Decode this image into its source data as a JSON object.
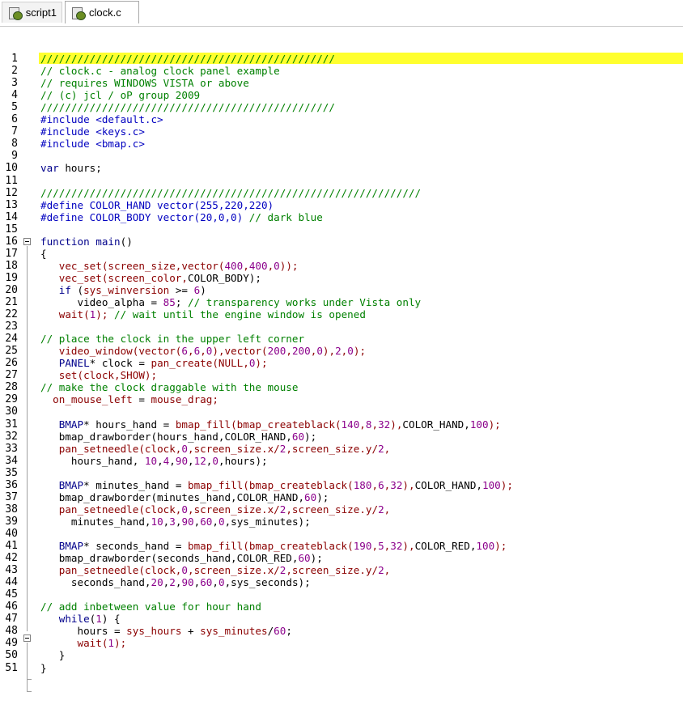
{
  "tabs": [
    {
      "label": "script1",
      "active": false,
      "icon": "script-file-icon"
    },
    {
      "label": "clock.c",
      "active": true,
      "icon": "script-file-icon"
    }
  ],
  "colors": {
    "highlight": "#ffff2e",
    "comment": "#008000",
    "keyword": "#00008b",
    "preprocessor": "#0000c0",
    "function": "#8b0000",
    "number": "#8b008b"
  },
  "lines": [
    {
      "n": "1",
      "segs": [
        [
          "cm",
          "////////////////////////////////////////////////"
        ]
      ]
    },
    {
      "n": "2",
      "segs": [
        [
          "cm",
          "// clock.c - analog clock panel example"
        ]
      ]
    },
    {
      "n": "3",
      "segs": [
        [
          "cm",
          "// requires WINDOWS VISTA or above"
        ]
      ]
    },
    {
      "n": "4",
      "segs": [
        [
          "cm",
          "// (c) jcl / oP group 2009"
        ]
      ]
    },
    {
      "n": "5",
      "segs": [
        [
          "cm",
          "////////////////////////////////////////////////"
        ]
      ]
    },
    {
      "n": "6",
      "segs": [
        [
          "pp",
          "#include <default.c>"
        ]
      ]
    },
    {
      "n": "7",
      "segs": [
        [
          "pp",
          "#include <keys.c>"
        ]
      ]
    },
    {
      "n": "8",
      "segs": [
        [
          "pp",
          "#include <bmap.c>"
        ]
      ]
    },
    {
      "n": "9",
      "segs": []
    },
    {
      "n": "10",
      "segs": [
        [
          "kw",
          "var"
        ],
        [
          "def",
          " hours;"
        ]
      ]
    },
    {
      "n": "11",
      "segs": []
    },
    {
      "n": "12",
      "segs": [
        [
          "cm",
          "//////////////////////////////////////////////////////////////"
        ]
      ]
    },
    {
      "n": "13",
      "segs": [
        [
          "pp",
          "#define COLOR_HAND vector(255,220,220)"
        ]
      ]
    },
    {
      "n": "14",
      "segs": [
        [
          "pp",
          "#define COLOR_BODY vector(20,0,0) "
        ],
        [
          "cm",
          "// dark blue"
        ]
      ]
    },
    {
      "n": "15",
      "segs": []
    },
    {
      "n": "16",
      "segs": [
        [
          "kw",
          "function"
        ],
        [
          "def",
          " "
        ],
        [
          "kw",
          "main"
        ],
        [
          "def",
          "()"
        ]
      ]
    },
    {
      "n": "17",
      "segs": [
        [
          "def",
          "{"
        ]
      ]
    },
    {
      "n": "18",
      "segs": [
        [
          "def",
          "   "
        ],
        [
          "fn",
          "vec_set(screen_size,vector("
        ],
        [
          "num",
          "400"
        ],
        [
          "fn",
          ","
        ],
        [
          "num",
          "400"
        ],
        [
          "fn",
          ","
        ],
        [
          "num",
          "0"
        ],
        [
          "fn",
          "));"
        ]
      ]
    },
    {
      "n": "19",
      "segs": [
        [
          "def",
          "   "
        ],
        [
          "fn",
          "vec_set(screen_color,"
        ],
        [
          "def",
          "COLOR_BODY);"
        ]
      ]
    },
    {
      "n": "20",
      "segs": [
        [
          "def",
          "   "
        ],
        [
          "kw",
          "if"
        ],
        [
          "def",
          " ("
        ],
        [
          "fn",
          "sys_winversion"
        ],
        [
          "def",
          " >= "
        ],
        [
          "num",
          "6"
        ],
        [
          "def",
          ")"
        ]
      ]
    },
    {
      "n": "21",
      "segs": [
        [
          "def",
          "      video_alpha = "
        ],
        [
          "num",
          "85"
        ],
        [
          "def",
          "; "
        ],
        [
          "cm",
          "// transparency works under Vista only"
        ]
      ]
    },
    {
      "n": "22",
      "segs": [
        [
          "def",
          "   "
        ],
        [
          "fn",
          "wait("
        ],
        [
          "num",
          "1"
        ],
        [
          "fn",
          ");"
        ],
        [
          "def",
          " "
        ],
        [
          "cm",
          "// wait until the engine window is opened"
        ]
      ]
    },
    {
      "n": "23",
      "segs": []
    },
    {
      "n": "24",
      "segs": [
        [
          "cm",
          "// place the clock in the upper left corner"
        ]
      ]
    },
    {
      "n": "25",
      "segs": [
        [
          "def",
          "   "
        ],
        [
          "fn",
          "video_window(vector("
        ],
        [
          "num",
          "6"
        ],
        [
          "fn",
          ","
        ],
        [
          "num",
          "6"
        ],
        [
          "fn",
          ","
        ],
        [
          "num",
          "0"
        ],
        [
          "fn",
          "),vector("
        ],
        [
          "num",
          "200"
        ],
        [
          "fn",
          ","
        ],
        [
          "num",
          "200"
        ],
        [
          "fn",
          ","
        ],
        [
          "num",
          "0"
        ],
        [
          "fn",
          "),"
        ],
        [
          "num",
          "2"
        ],
        [
          "fn",
          ","
        ],
        [
          "num",
          "0"
        ],
        [
          "fn",
          ");"
        ]
      ]
    },
    {
      "n": "26",
      "segs": [
        [
          "def",
          "   "
        ],
        [
          "kw",
          "PANEL"
        ],
        [
          "def",
          "* clock = "
        ],
        [
          "fn",
          "pan_create(NULL,"
        ],
        [
          "num",
          "0"
        ],
        [
          "fn",
          ");"
        ]
      ]
    },
    {
      "n": "27",
      "segs": [
        [
          "def",
          "   "
        ],
        [
          "fn",
          "set(clock,SHOW);"
        ]
      ]
    },
    {
      "n": "28",
      "segs": [
        [
          "cm",
          "// make the clock draggable with the mouse"
        ]
      ]
    },
    {
      "n": "29",
      "segs": [
        [
          "def",
          "  "
        ],
        [
          "fn",
          "on_mouse_left"
        ],
        [
          "def",
          " = "
        ],
        [
          "fn",
          "mouse_drag;"
        ]
      ]
    },
    {
      "n": "30",
      "segs": []
    },
    {
      "n": "31",
      "segs": [
        [
          "def",
          "   "
        ],
        [
          "kw",
          "BMAP"
        ],
        [
          "def",
          "* hours_hand = "
        ],
        [
          "fn",
          "bmap_fill(bmap_createblack("
        ],
        [
          "num",
          "140"
        ],
        [
          "fn",
          ","
        ],
        [
          "num",
          "8"
        ],
        [
          "fn",
          ","
        ],
        [
          "num",
          "32"
        ],
        [
          "fn",
          "),"
        ],
        [
          "def",
          "COLOR_HAND,"
        ],
        [
          "num",
          "100"
        ],
        [
          "fn",
          ");"
        ]
      ]
    },
    {
      "n": "32",
      "segs": [
        [
          "def",
          "   bmap_drawborder(hours_hand,COLOR_HAND,"
        ],
        [
          "num",
          "60"
        ],
        [
          "def",
          ");"
        ]
      ]
    },
    {
      "n": "33",
      "segs": [
        [
          "def",
          "   "
        ],
        [
          "fn",
          "pan_setneedle(clock,"
        ],
        [
          "num",
          "0"
        ],
        [
          "fn",
          ",screen_size.x/"
        ],
        [
          "num",
          "2"
        ],
        [
          "fn",
          ",screen_size.y/"
        ],
        [
          "num",
          "2"
        ],
        [
          "fn",
          ","
        ]
      ]
    },
    {
      "n": "34",
      "segs": [
        [
          "def",
          "     hours_hand, "
        ],
        [
          "num",
          "10"
        ],
        [
          "def",
          ","
        ],
        [
          "num",
          "4"
        ],
        [
          "def",
          ","
        ],
        [
          "num",
          "90"
        ],
        [
          "def",
          ","
        ],
        [
          "num",
          "12"
        ],
        [
          "def",
          ","
        ],
        [
          "num",
          "0"
        ],
        [
          "def",
          ",hours);"
        ]
      ]
    },
    {
      "n": "35",
      "segs": []
    },
    {
      "n": "36",
      "segs": [
        [
          "def",
          "   "
        ],
        [
          "kw",
          "BMAP"
        ],
        [
          "def",
          "* minutes_hand = "
        ],
        [
          "fn",
          "bmap_fill(bmap_createblack("
        ],
        [
          "num",
          "180"
        ],
        [
          "fn",
          ","
        ],
        [
          "num",
          "6"
        ],
        [
          "fn",
          ","
        ],
        [
          "num",
          "32"
        ],
        [
          "fn",
          "),"
        ],
        [
          "def",
          "COLOR_HAND,"
        ],
        [
          "num",
          "100"
        ],
        [
          "fn",
          ");"
        ]
      ]
    },
    {
      "n": "37",
      "segs": [
        [
          "def",
          "   bmap_drawborder(minutes_hand,COLOR_HAND,"
        ],
        [
          "num",
          "60"
        ],
        [
          "def",
          ");"
        ]
      ]
    },
    {
      "n": "38",
      "segs": [
        [
          "def",
          "   "
        ],
        [
          "fn",
          "pan_setneedle(clock,"
        ],
        [
          "num",
          "0"
        ],
        [
          "fn",
          ",screen_size.x/"
        ],
        [
          "num",
          "2"
        ],
        [
          "fn",
          ",screen_size.y/"
        ],
        [
          "num",
          "2"
        ],
        [
          "fn",
          ","
        ]
      ]
    },
    {
      "n": "39",
      "segs": [
        [
          "def",
          "     minutes_hand,"
        ],
        [
          "num",
          "10"
        ],
        [
          "def",
          ","
        ],
        [
          "num",
          "3"
        ],
        [
          "def",
          ","
        ],
        [
          "num",
          "90"
        ],
        [
          "def",
          ","
        ],
        [
          "num",
          "60"
        ],
        [
          "def",
          ","
        ],
        [
          "num",
          "0"
        ],
        [
          "def",
          ",sys_minutes);"
        ]
      ]
    },
    {
      "n": "40",
      "segs": []
    },
    {
      "n": "41",
      "segs": [
        [
          "def",
          "   "
        ],
        [
          "kw",
          "BMAP"
        ],
        [
          "def",
          "* seconds_hand = "
        ],
        [
          "fn",
          "bmap_fill(bmap_createblack("
        ],
        [
          "num",
          "190"
        ],
        [
          "fn",
          ","
        ],
        [
          "num",
          "5"
        ],
        [
          "fn",
          ","
        ],
        [
          "num",
          "32"
        ],
        [
          "fn",
          "),"
        ],
        [
          "def",
          "COLOR_RED,"
        ],
        [
          "num",
          "100"
        ],
        [
          "fn",
          ");"
        ]
      ]
    },
    {
      "n": "42",
      "segs": [
        [
          "def",
          "   bmap_drawborder(seconds_hand,COLOR_RED,"
        ],
        [
          "num",
          "60"
        ],
        [
          "def",
          ");"
        ]
      ]
    },
    {
      "n": "43",
      "segs": [
        [
          "def",
          "   "
        ],
        [
          "fn",
          "pan_setneedle(clock,"
        ],
        [
          "num",
          "0"
        ],
        [
          "fn",
          ",screen_size.x/"
        ],
        [
          "num",
          "2"
        ],
        [
          "fn",
          ",screen_size.y/"
        ],
        [
          "num",
          "2"
        ],
        [
          "fn",
          ","
        ]
      ]
    },
    {
      "n": "44",
      "segs": [
        [
          "def",
          "     seconds_hand,"
        ],
        [
          "num",
          "20"
        ],
        [
          "def",
          ","
        ],
        [
          "num",
          "2"
        ],
        [
          "def",
          ","
        ],
        [
          "num",
          "90"
        ],
        [
          "def",
          ","
        ],
        [
          "num",
          "60"
        ],
        [
          "def",
          ","
        ],
        [
          "num",
          "0"
        ],
        [
          "def",
          ",sys_seconds);"
        ]
      ]
    },
    {
      "n": "45",
      "segs": []
    },
    {
      "n": "46",
      "segs": [
        [
          "cm",
          "// add inbetween value for hour hand"
        ]
      ]
    },
    {
      "n": "47",
      "segs": [
        [
          "def",
          "   "
        ],
        [
          "kw",
          "while"
        ],
        [
          "def",
          "("
        ],
        [
          "num",
          "1"
        ],
        [
          "def",
          ") {"
        ]
      ]
    },
    {
      "n": "48",
      "segs": [
        [
          "def",
          "      hours = "
        ],
        [
          "fn",
          "sys_hours"
        ],
        [
          "def",
          " + "
        ],
        [
          "fn",
          "sys_minutes"
        ],
        [
          "def",
          "/"
        ],
        [
          "num",
          "60"
        ],
        [
          "def",
          ";"
        ]
      ]
    },
    {
      "n": "49",
      "segs": [
        [
          "def",
          "      "
        ],
        [
          "fn",
          "wait("
        ],
        [
          "num",
          "1"
        ],
        [
          "fn",
          ");"
        ]
      ]
    },
    {
      "n": "50",
      "segs": [
        [
          "def",
          "   }"
        ]
      ]
    },
    {
      "n": "51",
      "segs": [
        [
          "def",
          "}"
        ]
      ]
    }
  ]
}
